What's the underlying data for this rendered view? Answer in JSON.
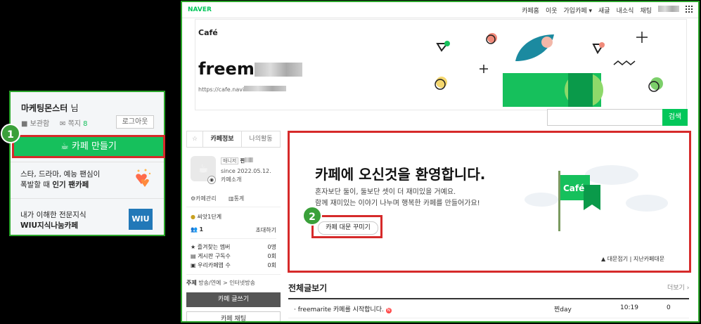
{
  "left_panel": {
    "username": "마케팅몬스터",
    "honorific": "님",
    "storage_label": "보관함",
    "notes_label": "쪽지",
    "notes_count": "8",
    "logout_label": "로그아웃",
    "make_cafe_label": "카페 만들기",
    "promo1_line1": "스타, 드라마, 예능 팬심이",
    "promo1_line2_pre": "폭발할 때 ",
    "promo1_line2_bold": "인기 팬카페",
    "promo2_line1": "내가 이해한 전문지식",
    "promo2_line2": "WIU지식나눔카페",
    "wiu_label": "WIU",
    "badge1": "1"
  },
  "topbar": {
    "brand": "NAVER",
    "nav": [
      "카페홈",
      "이웃",
      "가입카페 ▾",
      "새글",
      "내소식",
      "채팅"
    ],
    "grid_icon": "grid-icon"
  },
  "header": {
    "cafe_label": "Café",
    "title_prefix": "freem",
    "url_prefix": "https://cafe.navi"
  },
  "search": {
    "button_label": "검색"
  },
  "sidebar": {
    "tab_info": "카페정보",
    "tab_activity": "나의활동",
    "manager_tag": "매니저",
    "manager_name": "찐",
    "since": "since 2022.05.12.",
    "intro_link": "카페소개",
    "manage_link": "카페관리",
    "stats_link": "통계",
    "level": "씨앗1단계",
    "members_count": "1",
    "invite_label": "초대하기",
    "stats": [
      {
        "label": "즐겨찾는 멤버",
        "value": "0명"
      },
      {
        "label": "게시판 구독수",
        "value": "0회"
      },
      {
        "label": "우리카페앱 수",
        "value": "0회"
      }
    ],
    "topic_label": "주제",
    "topic_value": "방송/연예 > 인터넷방송",
    "write_button": "카페 글쓰기",
    "chat_button": "카페 채팅"
  },
  "welcome": {
    "title": "카페에 오신것을 환영합니다.",
    "line1": "혼자보단 둘이, 둘보단 셋이 더 재미있을 거예요.",
    "line2": "함께 재미있는 이야기 나누며 행복한 카페를 만들어가요!",
    "decorate_button": "카페 대문 꾸미기",
    "fold_link": "▲ 대문접기",
    "prev_link": "지난카페대문",
    "flag_label": "Café",
    "badge2": "2"
  },
  "board": {
    "title": "전체글보기",
    "more": "더보기 ›",
    "rows": [
      {
        "title": "freemarite 카페를 시작합니다.",
        "new": "N",
        "author": "찐day",
        "time": "10:19",
        "views": "0"
      }
    ]
  },
  "colors": {
    "accent": "#03c75a",
    "highlight_border": "#d62a2a",
    "frame_green": "#2aa52a"
  }
}
